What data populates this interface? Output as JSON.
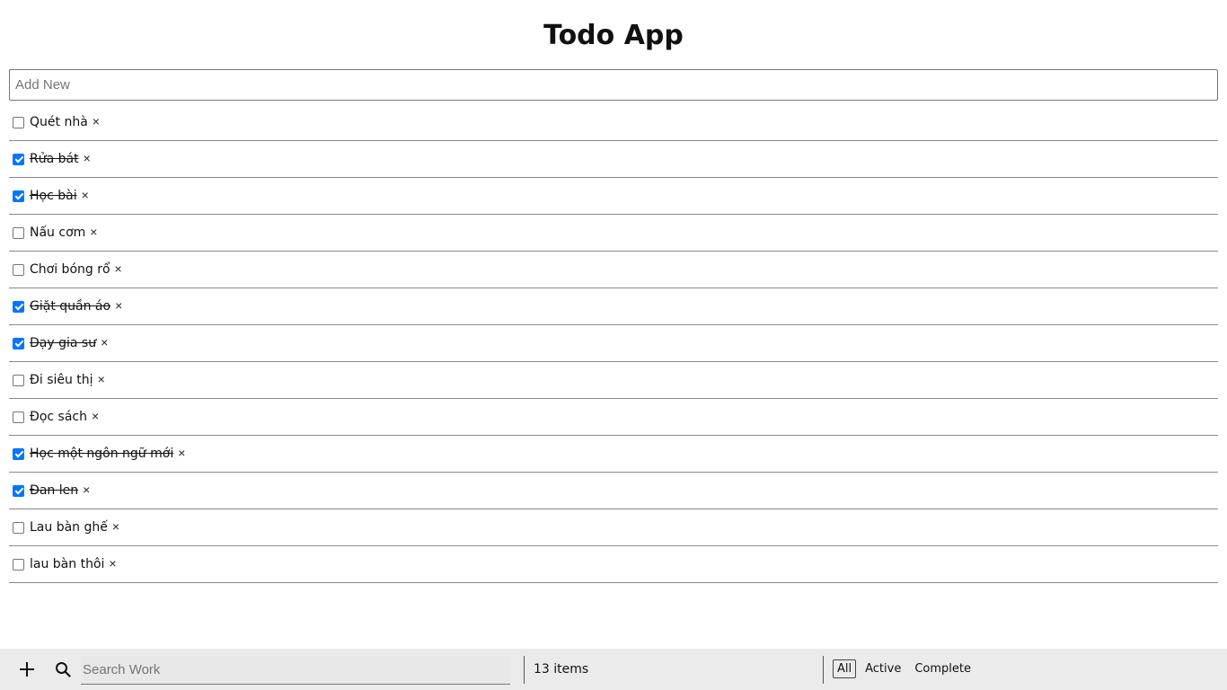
{
  "header": {
    "title": "Todo App"
  },
  "add_new": {
    "placeholder": "Add New",
    "value": ""
  },
  "todos": [
    {
      "label": "Quét nhà",
      "done": false
    },
    {
      "label": "Rửa bát",
      "done": true
    },
    {
      "label": "Học bài",
      "done": true
    },
    {
      "label": "Nấu cơm",
      "done": false
    },
    {
      "label": "Chơi bóng rổ",
      "done": false
    },
    {
      "label": "Giặt quần áo",
      "done": true
    },
    {
      "label": "Dạy gia sư",
      "done": true
    },
    {
      "label": "Đi siêu thị",
      "done": false
    },
    {
      "label": "Đọc sách",
      "done": false
    },
    {
      "label": "Học một ngôn ngữ mới",
      "done": true
    },
    {
      "label": "Đan len",
      "done": true
    },
    {
      "label": "Lau bàn ghế",
      "done": false
    },
    {
      "label": "lau bàn thôi",
      "done": false
    }
  ],
  "delete_glyph": "×",
  "footer": {
    "add_icon": "plus-icon",
    "search_icon": "search-icon",
    "search": {
      "placeholder": "Search Work",
      "value": ""
    },
    "items_count": "13 items",
    "filters": [
      {
        "label": "All",
        "active": true
      },
      {
        "label": "Active",
        "active": false
      },
      {
        "label": "Complete",
        "active": false
      }
    ]
  },
  "colors": {
    "checkbox_checked": "#0075ff",
    "footer_bg": "#ebebeb"
  }
}
